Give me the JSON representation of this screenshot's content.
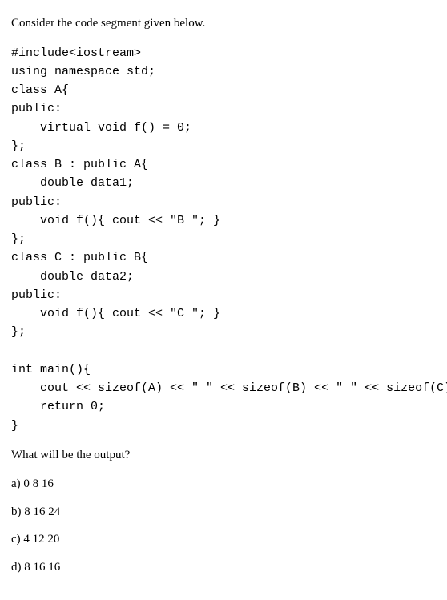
{
  "prompt": "Consider the code segment given below.",
  "code": "#include<iostream>\nusing namespace std;\nclass A{\npublic:\n    virtual void f() = 0;\n};\nclass B : public A{\n    double data1;\npublic:\n    void f(){ cout << \"B \"; }\n};\nclass C : public B{\n    double data2;\npublic:\n    void f(){ cout << \"C \"; }\n};\n\nint main(){\n    cout << sizeof(A) << \" \" << sizeof(B) << \" \" << sizeof(C);\n    return 0;\n}",
  "question": "What will be the output?",
  "options": [
    "a) 0 8 16",
    "b) 8 16 24",
    "c) 4 12 20",
    "d) 8 16 16"
  ]
}
